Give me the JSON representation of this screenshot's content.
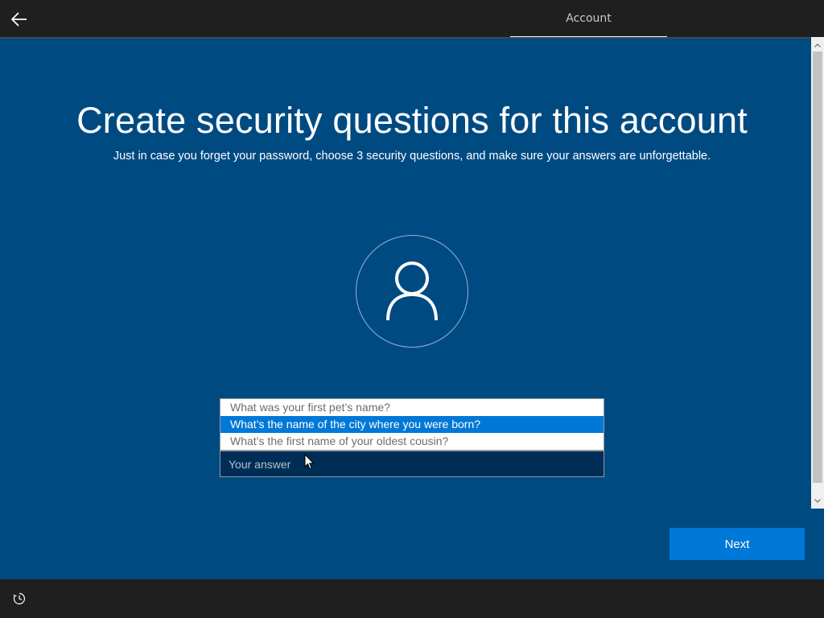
{
  "header": {
    "back_icon": "back-arrow-icon",
    "tab_label": "Account"
  },
  "main": {
    "title": "Create security questions for this account",
    "subtitle": "Just in case you forget your password, choose 3 security questions, and make sure your answers are unforgettable.",
    "avatar_icon": "user-icon",
    "question_options": [
      "What was your first pet’s name?",
      "What’s the name of the city where you were born?",
      "What’s the first name of your oldest cousin?"
    ],
    "selected_option": "What’s the name of the city where you were born?",
    "answer_placeholder": "Your answer",
    "answer_value": "",
    "next_label": "Next"
  },
  "footer": {
    "accessibility_icon": "accessibility-icon"
  },
  "colors": {
    "background": "#004a82",
    "accent": "#0078d7",
    "bar": "#1f1f1f"
  }
}
